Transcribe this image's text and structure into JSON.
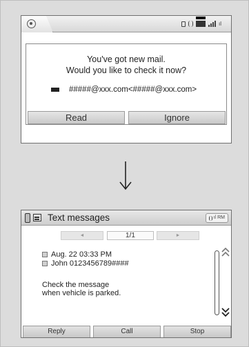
{
  "screen1": {
    "dialog": {
      "message_line1": "You've got new mail.",
      "message_line2": "Would you like to check it now?",
      "address": "#####@xxx.com<#####@xxx.com>"
    },
    "buttons": {
      "read_label": "Read",
      "ignore_label": "Ignore"
    }
  },
  "screen2": {
    "title": "Text messages",
    "status": "RM",
    "pager": {
      "prev_label": "◄",
      "count": "1/1",
      "next_label": "►"
    },
    "message": {
      "date": "Aug. 22 03:33 PM",
      "sender": "John 0123456789####",
      "body_line1": "Check the message",
      "body_line2": "when vehicle is parked."
    },
    "buttons": {
      "reply_label": "Reply",
      "call_label": "Call",
      "stop_label": "Stop"
    },
    "scroll": {
      "up_icon": "double-chevron-up",
      "down_icon": "double-chevron-down"
    }
  }
}
